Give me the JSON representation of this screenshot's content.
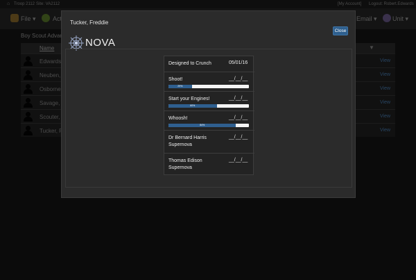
{
  "topbar": {
    "troop": "Troop 2112",
    "site": "Site: VA2112",
    "account": "[My Account]",
    "logout": "Logout: Robert.Edwards"
  },
  "nav": {
    "file": "File",
    "activities": "Act",
    "email": "Email",
    "unit": "Unit"
  },
  "background": {
    "heading": "Boy Scout Advance",
    "name_header": "Name",
    "rows": [
      {
        "name": "Edwards,",
        "action": "View"
      },
      {
        "name": "Neuben, I",
        "action": "View"
      },
      {
        "name": "Osborne,",
        "action": "View"
      },
      {
        "name": "Savage, R",
        "action": "View"
      },
      {
        "name": "Scouter,",
        "action": "View"
      },
      {
        "name": "Tucker, F",
        "action": "View"
      }
    ]
  },
  "modal": {
    "title": "Tucker, Freddie",
    "close_label": "Close",
    "award": "NOVA",
    "requirements": [
      {
        "name": "Designed to Crunch",
        "date": "05/01/16"
      },
      {
        "name": "Shoot!",
        "date": "__/__/__",
        "progress": 29,
        "progress_label": "29%"
      },
      {
        "name": "Start your Engines!",
        "date": "__/__/__",
        "progress": 60,
        "progress_label": "60%"
      },
      {
        "name": "Whoosh!",
        "date": "__/__/__",
        "progress": 84,
        "progress_label": "84%"
      },
      {
        "name": "Dr Bernard Harris Supernova",
        "date": "__/__/__"
      },
      {
        "name": "Thomas Edison Supernova",
        "date": "__/__/__"
      }
    ]
  },
  "colors": {
    "accent": "#2f5f8f",
    "link": "#4a7fb5",
    "modal_bg": "#2b2b2b"
  }
}
